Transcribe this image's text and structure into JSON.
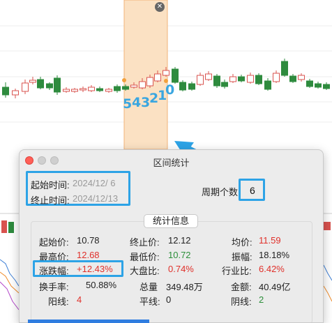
{
  "chart": {
    "close_icon": "close-icon",
    "period_digits": [
      "5",
      "4",
      "3",
      "2",
      "1",
      "0"
    ],
    "selection_color": "#fbe1c3",
    "up_color": "#d9534f",
    "down_color": "#2e8b3e",
    "annotation_color": "#2da3e6"
  },
  "dialog": {
    "title": "区间统计",
    "start_label": "起始时间:",
    "start_value": "2024/12/  6",
    "end_label": "终止时间:",
    "end_value": "2024/12/13",
    "period_count_label": "周期个数:",
    "period_count_value": "6",
    "stats_tab": "统计信息",
    "stats": {
      "open_label": "起始价:",
      "open_value": "10.78",
      "close_label": "终止价:",
      "close_value": "12.12",
      "avg_label": "均价:",
      "avg_value": "11.59",
      "high_label": "最高价:",
      "high_value": "12.68",
      "low_label": "最低价:",
      "low_value": "10.72",
      "amp_label": "振幅:",
      "amp_value": "18.18%",
      "chg_label": "涨跌幅:",
      "chg_value": "+12.43%",
      "market_label": "大盘比:",
      "market_value": "0.74%",
      "industry_label": "行业比:",
      "industry_value": "6.42%",
      "turnover_label": "换手率:",
      "turnover_value": "50.88%",
      "volume_label": "总量",
      "volume_value": "349.48万",
      "amount_label": "金额:",
      "amount_value": "40.49亿",
      "yang_label": "阳线:",
      "yang_value": "4",
      "flat_label": "平线:",
      "flat_value": "0",
      "yin_label": "阴线:",
      "yin_value": "2"
    }
  }
}
